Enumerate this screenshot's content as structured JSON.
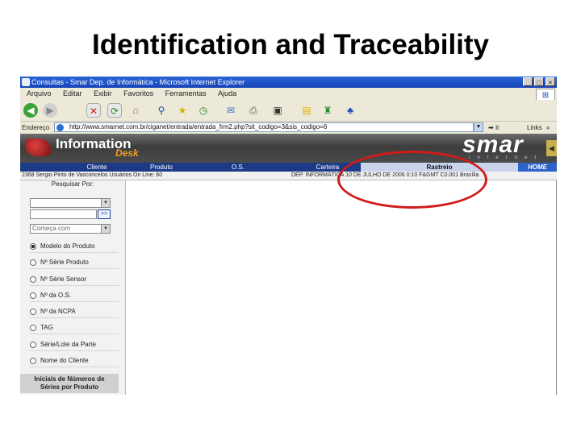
{
  "slide": {
    "title": "Identification and Traceability"
  },
  "window": {
    "title": "Consultas - Smar Dep. de Informática - Microsoft Internet Explorer",
    "buttons": [
      "_",
      "□",
      "×"
    ]
  },
  "menu": {
    "items": [
      "Arquivo",
      "Editar",
      "Exibir",
      "Favoritos",
      "Ferramentas",
      "Ajuda"
    ]
  },
  "toolbar": {
    "icons": [
      "back-icon",
      "forward-icon",
      "stop-icon",
      "refresh-icon",
      "home-icon",
      "search-icon",
      "favorites-icon",
      "history-icon",
      "mail-icon",
      "print-icon",
      "edit-icon",
      "discuss-icon",
      "messenger-icon",
      "msn-icon"
    ]
  },
  "address": {
    "label": "Endereço",
    "url": "http://www.smarnet.com.br/ciganet/entrada/entrada_frm2.php?sit_codigo=3&sis_codigo=6",
    "go": "Ir",
    "links": "Links",
    "chevron": "»"
  },
  "banner": {
    "logo_text": "Information",
    "logo_sub": "Desk",
    "brand": "smar",
    "brand_sub": "internet",
    "colors": {
      "nav": "#1c3a86",
      "active_tab": "#c9d4ec",
      "home": "#2d63c8",
      "logo_orange": "#f0a020"
    }
  },
  "nav": {
    "items": [
      {
        "label": "Cliente"
      },
      {
        "label": "Produto"
      },
      {
        "label": "O.S."
      },
      {
        "label": "Carteira"
      },
      {
        "label": "Rastreio"
      },
      {
        "label": "HOME"
      }
    ]
  },
  "status": {
    "left": "2368  Sergio Pinto de Vasconcelos   Usuários On Line: 60",
    "right": "DEP. INFORMÁTICA    10 DE JULHO DE 2006 0:10 F&GMT C0.001 Brasília"
  },
  "sidebar": {
    "search_label": "Pesquisar Por:",
    "select1": "",
    "select2": "",
    "go": ">>",
    "match_select": "Começa com",
    "options": [
      {
        "label": "Modelo do Produto",
        "selected": true
      },
      {
        "label": "Nº Série Produto",
        "selected": false
      },
      {
        "label": "Nº Série Sensor",
        "selected": false
      },
      {
        "label": "Nº da O.S.",
        "selected": false
      },
      {
        "label": "Nº da NCPA",
        "selected": false
      },
      {
        "label": "TAG",
        "selected": false
      },
      {
        "label": "Série/Lote da Parte",
        "selected": false
      },
      {
        "label": "Nome do Cliente",
        "selected": false
      }
    ],
    "initials_line1": "Iniciais de Números de",
    "initials_line2": "Séries por Produto"
  },
  "annotation": {
    "color": "#d11a1a",
    "target": "Rastreio"
  }
}
